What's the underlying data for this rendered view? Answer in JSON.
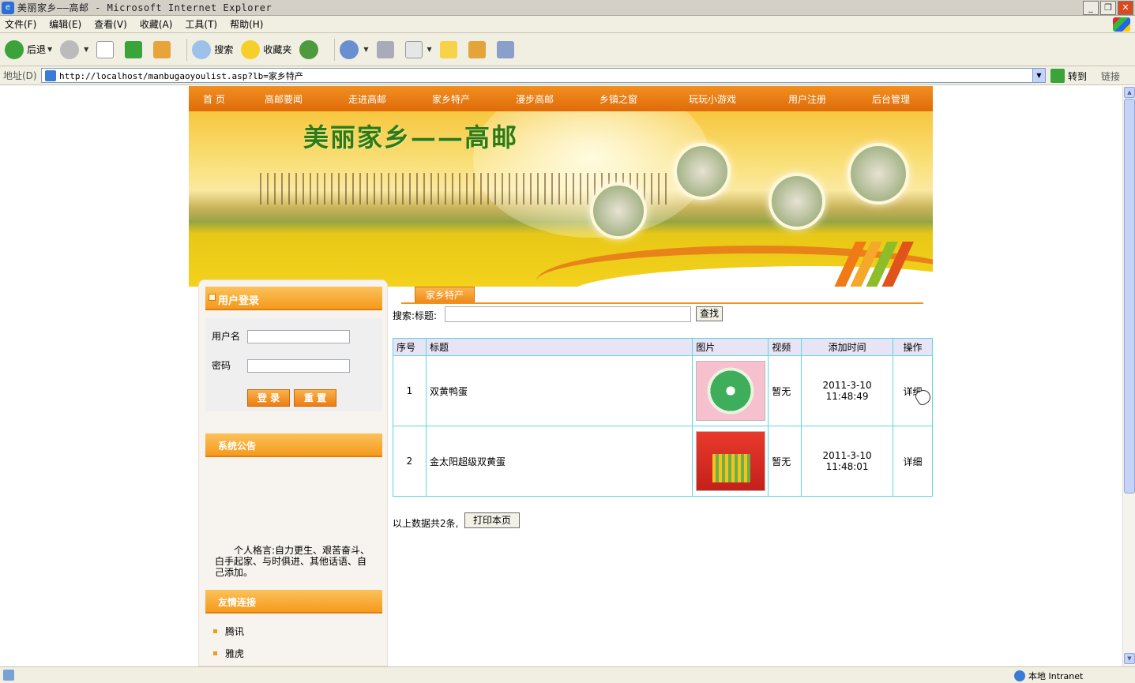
{
  "window": {
    "title": "美丽家乡——高邮 - Microsoft Internet Explorer",
    "buttons": [
      "_",
      "❐",
      "✕"
    ]
  },
  "menu": [
    "文件(F)",
    "编辑(E)",
    "查看(V)",
    "收藏(A)",
    "工具(T)",
    "帮助(H)"
  ],
  "toolbar": {
    "back": "后退",
    "search": "搜索",
    "favorites": "收藏夹"
  },
  "address": {
    "label": "地址(D)",
    "url": "http://localhost/manbugaoyoulist.asp?lb=家乡特产",
    "goto": "转到",
    "links": "链接"
  },
  "nav": [
    "首 页",
    "高邮要闻",
    "走进高邮",
    "家乡特产",
    "漫步高邮",
    "乡镇之窗",
    "玩玩小游戏",
    "用户注册",
    "后台管理"
  ],
  "banner": {
    "title": "美丽家乡——高邮"
  },
  "login": {
    "header": "用户登录",
    "username_label": "用户名",
    "password_label": "密码",
    "login_btn": "登 录",
    "reset_btn": "重 置"
  },
  "notice": {
    "header": "系统公告",
    "text": "个人格言:自力更生、艰苦奋斗、白手起家、与时俱进、其他话语、自己添加。"
  },
  "friend_links": {
    "header": "友情连接",
    "items": [
      "腾讯",
      "雅虎"
    ]
  },
  "content": {
    "tab": "家乡特产",
    "search_label": "搜索:标题:",
    "search_btn": "查找",
    "columns": [
      "序号",
      "标题",
      "图片",
      "视频",
      "添加时间",
      "操作"
    ],
    "rows": [
      {
        "no": "1",
        "title": "双黄鸭蛋",
        "video": "暂无",
        "time": "2011-3-10 11:48:49",
        "action": "详细"
      },
      {
        "no": "2",
        "title": "金太阳超级双黄蛋",
        "video": "暂无",
        "time": "2011-3-10 11:48:01",
        "action": "详细"
      }
    ],
    "total": "以上数据共2条,",
    "print_btn": "打印本页"
  },
  "status": {
    "zone": "本地 Intranet"
  }
}
